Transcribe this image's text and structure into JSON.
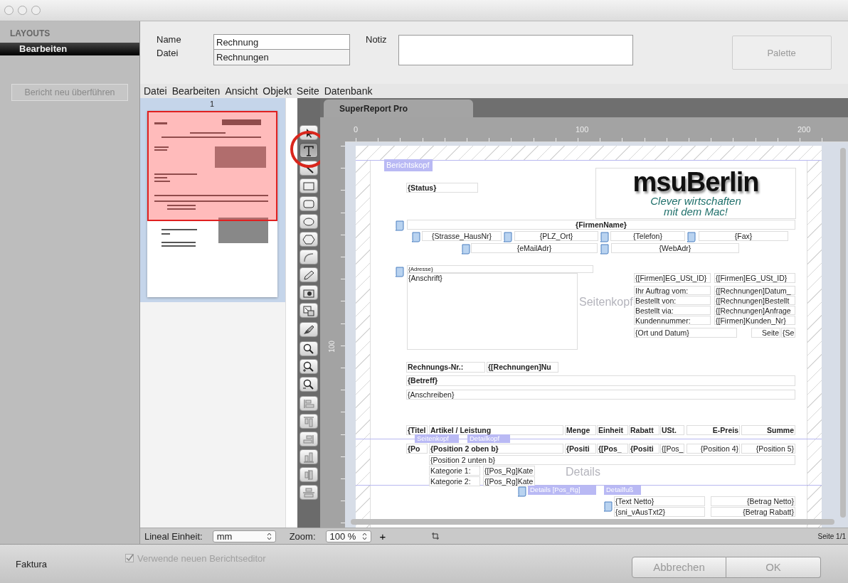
{
  "sidebar": {
    "heading": "LAYOUTS",
    "items": [
      {
        "label": "Bearbeiten",
        "selected": true
      }
    ],
    "button": {
      "label": "Bericht neu überführen",
      "disabled": true
    }
  },
  "form": {
    "name_label": "Name",
    "name_value": "Rechnung",
    "file_label": "Datei",
    "file_value": "Rechnungen",
    "note_label": "Notiz",
    "palette_button": {
      "label": "Palette",
      "disabled": true
    }
  },
  "menu": [
    "Datei",
    "Bearbeiten",
    "Ansicht",
    "Objekt",
    "Seite",
    "Datenbank"
  ],
  "thumbnails": [
    {
      "label": "1",
      "selected": true
    }
  ],
  "tool_groups": [
    [
      {
        "kind": "pointer",
        "selected": false
      },
      {
        "kind": "text",
        "selected": true
      },
      {
        "kind": "line",
        "selected": false
      },
      {
        "kind": "rect",
        "selected": false
      },
      {
        "kind": "roundrect",
        "selected": false
      },
      {
        "kind": "ellipse",
        "selected": false
      },
      {
        "kind": "hexagon",
        "selected": false
      },
      {
        "kind": "arc",
        "selected": false
      },
      {
        "kind": "pencil",
        "selected": false
      },
      {
        "kind": "camera",
        "selected": false
      },
      {
        "kind": "resize",
        "selected": false
      }
    ],
    [
      {
        "kind": "brush",
        "selected": false
      }
    ],
    [
      {
        "kind": "zoom",
        "selected": false
      },
      {
        "kind": "zoomin",
        "selected": false
      },
      {
        "kind": "zoomout",
        "selected": false
      }
    ],
    [
      {
        "kind": "alignleft",
        "selected": false
      },
      {
        "kind": "aligntop",
        "selected": false
      },
      {
        "kind": "alignright",
        "selected": false
      },
      {
        "kind": "alignbottom",
        "selected": false
      },
      {
        "kind": "centerh",
        "selected": false
      },
      {
        "kind": "centerv",
        "selected": false
      }
    ]
  ],
  "editor_tab": {
    "label": "SuperReport Pro"
  },
  "rulers": {
    "horizontal": [
      "0",
      "100",
      "200"
    ],
    "vertical": [
      "100"
    ]
  },
  "report": {
    "band_tags": [
      "Berichtskopf",
      "Seitenkopf",
      "Detailkopf",
      "Details [Pos_Rg]",
      "Detailfuß"
    ],
    "band_watermarks": [
      "Seitenkopf",
      "Details"
    ],
    "logo": {
      "name": "msuBerlin",
      "slogan": [
        "Clever wirtschaften",
        "mit dem Mac!"
      ]
    },
    "fields": [
      "{Status}",
      "{FirmenName}",
      "{Strasse_HausNr}",
      "{PLZ_Ort}",
      "{Telefon}",
      "{Fax}",
      "{eMailAdr}",
      "{WebAdr}",
      "{Adresse}",
      "{Anschrift}",
      "{[Firmen]EG_USt_ID}",
      "{[Firmen]EG_USt_ID}",
      "Ihr Auftrag vom:",
      "{[Rechnungen]Datum_",
      "Bestellt von:",
      "{[Rechnungen]Bestellt",
      "Bestellt via:",
      "{[Rechnungen]Anfrage",
      "Kundennummer:",
      "{[Firmen]Kunden_Nr}",
      "{Ort und Datum}",
      "Seite",
      "{Se",
      "Rechnungs-Nr.:",
      "{[Rechnungen]Nu",
      "{Betreff}",
      "{Anschreiben}",
      "{Titel",
      "Artikel / Leistung",
      "Menge",
      "Einheit",
      "Rabatt",
      "USt.",
      "E-Preis",
      "Summe",
      "{Po",
      "{Position 2 oben b}",
      "{Positi",
      "{[Pos_",
      "{Positi",
      "{[Pos_",
      "{Position 4}",
      "{Position 5}",
      "{Position 2 unten b}",
      "Kategorie 1:",
      "{[Pos_Rg]Kate",
      "Kategorie 2:",
      "{[Pos_Rg]Kate",
      "{Text Netto}",
      "{Betrag Netto}",
      "{sni_vAusTxt2}",
      "{Betrag Rabatt}"
    ]
  },
  "bottom_bar": {
    "unit_label": "Lineal Einheit:",
    "unit_value": "mm",
    "zoom_label": "Zoom:",
    "zoom_value": "100 %",
    "add_label": "+",
    "page_info": "Seite 1/1"
  },
  "footer": {
    "app_name": "Faktura",
    "checkbox": {
      "label": "Verwende neuen Berichtseditor",
      "checked": true,
      "disabled": true
    },
    "buttons": [
      {
        "label": "Abbrechen",
        "disabled": true
      },
      {
        "label": "OK",
        "disabled": true
      }
    ]
  }
}
